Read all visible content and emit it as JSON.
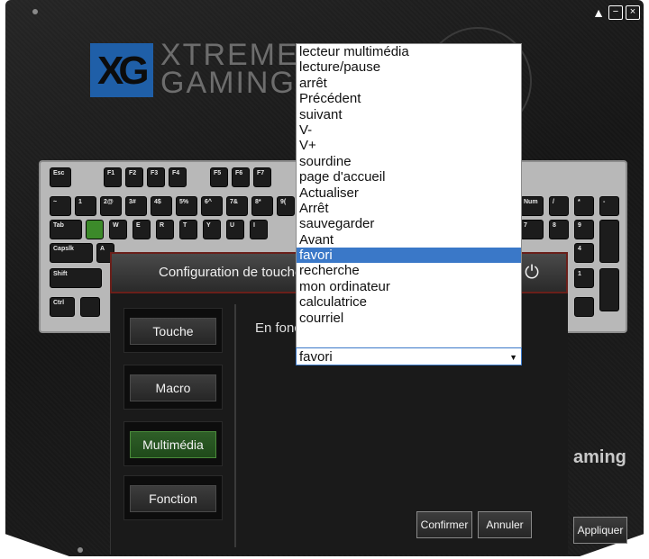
{
  "window_controls": {
    "eject": "▲",
    "minimize": "−",
    "close": "×"
  },
  "logo": {
    "mark": "XG",
    "line1": "XTREME",
    "line2": "GAMING"
  },
  "brand_right": "aming",
  "keyboard": {
    "rows": [
      [
        "Esc",
        "F1",
        "F2",
        "F3",
        "F4",
        "F5",
        "F6",
        "F7"
      ],
      [
        "~",
        "1",
        "2@",
        "3#",
        "4$",
        "5%",
        "6^",
        "7&",
        "8*",
        "9("
      ],
      [
        "Tab",
        "",
        "W",
        "E",
        "R",
        "T",
        "Y",
        "U",
        "I"
      ],
      [
        "Capslk",
        "A"
      ],
      [
        "Shift"
      ],
      [
        "Ctrl",
        ""
      ]
    ],
    "right_rows": [
      [
        "Num",
        "/",
        "*",
        "-"
      ],
      [
        "7",
        "8",
        "9",
        ""
      ],
      [
        "4",
        "",
        ""
      ],
      [
        "1",
        ""
      ]
    ]
  },
  "dialog": {
    "title": "Configuration de touche",
    "mode_text": "En fonction",
    "side_buttons": [
      {
        "label": "Touche"
      },
      {
        "label": "Macro"
      },
      {
        "label": "Multimédia"
      },
      {
        "label": "Fonction"
      }
    ],
    "confirm_label": "Confirmer",
    "cancel_label": "Annuler"
  },
  "apply_label": "Appliquer",
  "dropdown": {
    "options": [
      "lecteur multimédia",
      "lecture/pause",
      "arrêt",
      "Précédent",
      "suivant",
      "V-",
      "V+",
      "sourdine",
      "page d'accueil",
      "Actualiser",
      "Arrêt",
      "sauvegarder",
      "Avant",
      "favori",
      "recherche",
      "mon ordinateur",
      "calculatrice",
      "courriel"
    ],
    "selected_index": 13,
    "selected_value": "favori"
  }
}
